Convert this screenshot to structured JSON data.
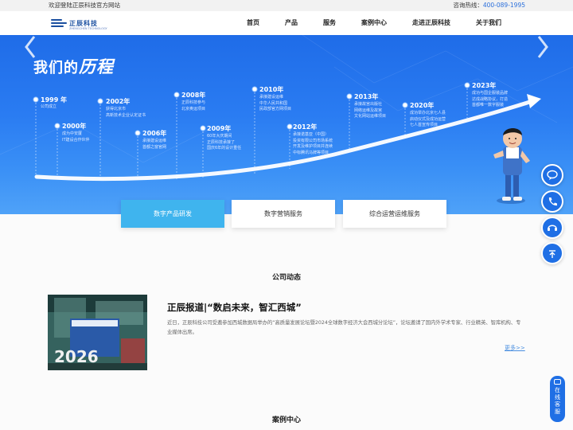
{
  "topbar": {
    "welcome": "欢迎登陆正辰科技官方网站",
    "hotline_label": "咨询热线：",
    "hotline_number": "400-089-1995"
  },
  "logo": {
    "name": "正辰科技",
    "sub": "ZHENGCHEN TECHNOLOGY"
  },
  "nav": [
    "首页",
    "产品",
    "服务",
    "案例中心",
    "走进正辰科技",
    "关于我们"
  ],
  "banner": {
    "title_a": "我们的",
    "title_b": "历程",
    "milestones": [
      {
        "year": "1999 年",
        "desc": "公司成立"
      },
      {
        "year": "2000年",
        "desc": "成为中安厦\nIT建设合作伙伴"
      },
      {
        "year": "2002年",
        "desc": "获得北京市\n高新技术企业认定证书"
      },
      {
        "year": "2006年",
        "desc": "承接建设运维\n首都之窗官网"
      },
      {
        "year": "2008年",
        "desc": "正辰科技参与\n北京奥运项目"
      },
      {
        "year": "2009年",
        "desc": "60年大庆期间\n正辰科技承接了\n国庆6年的设计重任"
      },
      {
        "year": "2010年",
        "desc": "承接建设运维\n中华人民共和国\n民政部官方网项目"
      },
      {
        "year": "2012年",
        "desc": "承接诺基亚（中国）\n投资有限公司市场系统\n开发及维护项目并连续\n中标腾讯马牌等项目"
      },
      {
        "year": "2013年",
        "desc": "承接故宫出版社\n网络运维及故宫\n文化网站运维项目"
      },
      {
        "year": "2020年",
        "desc": "成功举办北京七人县\n启动仪式及成功运营\n七人首宣传项目"
      },
      {
        "year": "2023年",
        "desc": "成功与国企服装品牌\n达成战略协议，打造\n首都唯一数字服装"
      }
    ]
  },
  "tabs": [
    "数字产品研发",
    "数字营销服务",
    "综合运营运维服务"
  ],
  "news": {
    "section_title": "公司动态",
    "title": "正辰报道|“数启未来，智汇西城”",
    "body": "近日，正辰科技公司受邀参加西城数据局举办的“高质量发展论坛暨2024全球数字经济大会西城分论坛”，论坛邀请了国内外学术专家、行业精英、智库机构、专业媒体出席。",
    "more": "更多>>",
    "image_text": "2026"
  },
  "cases": {
    "section_title": "案例中心"
  },
  "sidebar": {
    "chat_label": "在线客服"
  },
  "colors": {
    "brand": "#1f6fe5",
    "tab_active": "#3fb4ee",
    "link": "#2a6fdb"
  }
}
